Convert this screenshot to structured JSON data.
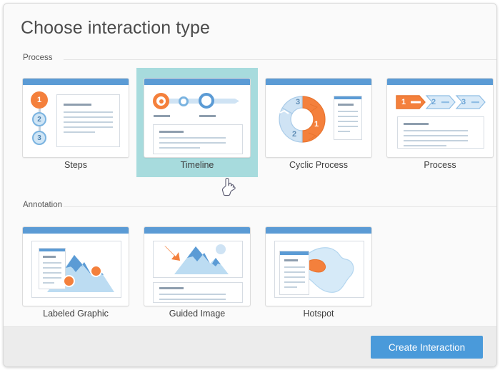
{
  "dialog": {
    "title": "Choose interaction type"
  },
  "sections": [
    {
      "id": "process",
      "label": "Process"
    },
    {
      "id": "annotation",
      "label": "Annotation"
    }
  ],
  "process_cards": [
    {
      "id": "steps",
      "label": "Steps",
      "selected": false,
      "numbers": [
        "1",
        "2",
        "3"
      ]
    },
    {
      "id": "timeline",
      "label": "Timeline",
      "selected": true
    },
    {
      "id": "cyclic-process",
      "label": "Cyclic Process",
      "selected": false,
      "numbers": [
        "1",
        "2",
        "3"
      ]
    },
    {
      "id": "process",
      "label": "Process",
      "selected": false,
      "numbers": [
        "1",
        "2",
        "3"
      ]
    }
  ],
  "annotation_cards": [
    {
      "id": "labeled-graphic",
      "label": "Labeled Graphic",
      "selected": false
    },
    {
      "id": "guided-image",
      "label": "Guided Image",
      "selected": false
    },
    {
      "id": "hotspot",
      "label": "Hotspot",
      "selected": false
    }
  ],
  "footer": {
    "create_label": "Create Interaction"
  },
  "cursor": {
    "icon": "pointing-hand-cursor"
  },
  "colors": {
    "accent_blue": "#4a9ada",
    "selection_teal": "#a7dbdd",
    "thumb_header_blue": "#5b9bd5",
    "highlight_orange": "#f4803c",
    "dialog_bg": "#fafafa",
    "footer_bg": "#ececec"
  }
}
